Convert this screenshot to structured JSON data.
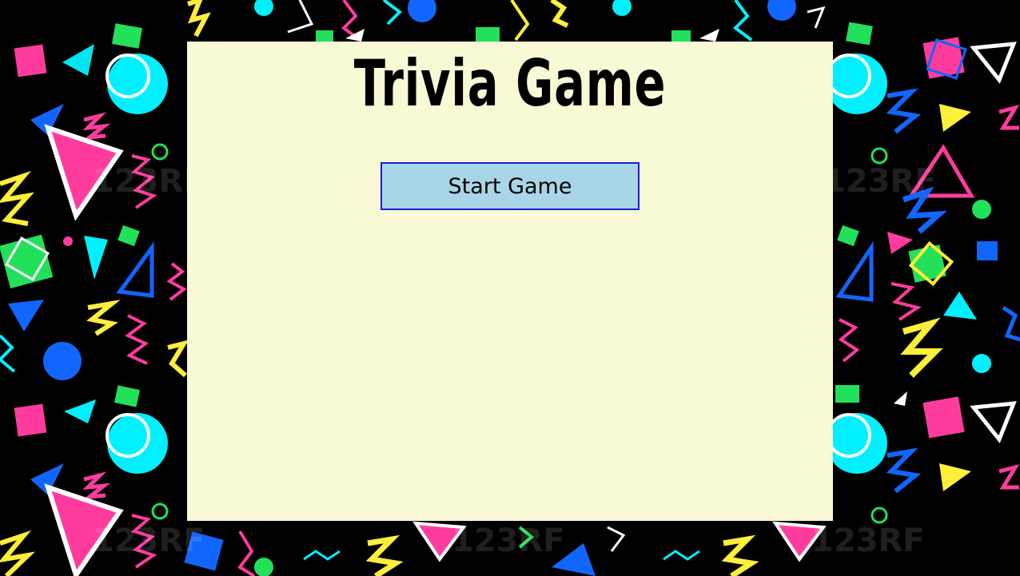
{
  "page": {
    "title": "Trivia Game",
    "start_button_label": "Start Game"
  },
  "theme": {
    "panel_color": "#f9f9d6",
    "button_fill": "#a9d6e6",
    "button_border": "#1a1adb",
    "pattern_colors": [
      "#ff3c9e",
      "#00f0ff",
      "#ffef3a",
      "#1166ff",
      "#22e05a",
      "#ffffff"
    ]
  },
  "background": {
    "style": "80s memphis pattern",
    "watermark": "123RF"
  }
}
